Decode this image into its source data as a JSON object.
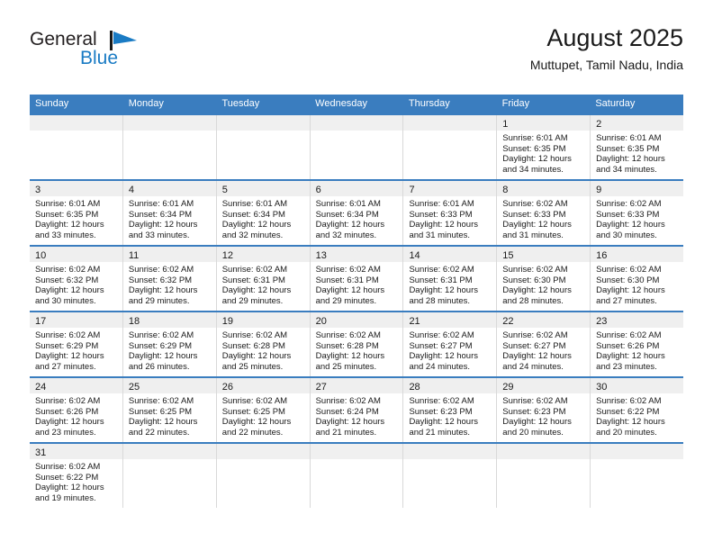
{
  "brand": {
    "name_part1": "General",
    "name_part2": "Blue",
    "logo_icon": "triangle-flag-icon",
    "accent_color": "#1a7bc4"
  },
  "header": {
    "title": "August 2025",
    "location": "Muttupet, Tamil Nadu, India"
  },
  "calendar": {
    "header_bg": "#3A7DBF",
    "daynum_bg": "#efefef",
    "weekdays": [
      "Sunday",
      "Monday",
      "Tuesday",
      "Wednesday",
      "Thursday",
      "Friday",
      "Saturday"
    ],
    "weeks": [
      [
        {
          "day": "",
          "lines": []
        },
        {
          "day": "",
          "lines": []
        },
        {
          "day": "",
          "lines": []
        },
        {
          "day": "",
          "lines": []
        },
        {
          "day": "",
          "lines": []
        },
        {
          "day": "1",
          "lines": [
            "Sunrise: 6:01 AM",
            "Sunset: 6:35 PM",
            "Daylight: 12 hours",
            "and 34 minutes."
          ]
        },
        {
          "day": "2",
          "lines": [
            "Sunrise: 6:01 AM",
            "Sunset: 6:35 PM",
            "Daylight: 12 hours",
            "and 34 minutes."
          ]
        }
      ],
      [
        {
          "day": "3",
          "lines": [
            "Sunrise: 6:01 AM",
            "Sunset: 6:35 PM",
            "Daylight: 12 hours",
            "and 33 minutes."
          ]
        },
        {
          "day": "4",
          "lines": [
            "Sunrise: 6:01 AM",
            "Sunset: 6:34 PM",
            "Daylight: 12 hours",
            "and 33 minutes."
          ]
        },
        {
          "day": "5",
          "lines": [
            "Sunrise: 6:01 AM",
            "Sunset: 6:34 PM",
            "Daylight: 12 hours",
            "and 32 minutes."
          ]
        },
        {
          "day": "6",
          "lines": [
            "Sunrise: 6:01 AM",
            "Sunset: 6:34 PM",
            "Daylight: 12 hours",
            "and 32 minutes."
          ]
        },
        {
          "day": "7",
          "lines": [
            "Sunrise: 6:01 AM",
            "Sunset: 6:33 PM",
            "Daylight: 12 hours",
            "and 31 minutes."
          ]
        },
        {
          "day": "8",
          "lines": [
            "Sunrise: 6:02 AM",
            "Sunset: 6:33 PM",
            "Daylight: 12 hours",
            "and 31 minutes."
          ]
        },
        {
          "day": "9",
          "lines": [
            "Sunrise: 6:02 AM",
            "Sunset: 6:33 PM",
            "Daylight: 12 hours",
            "and 30 minutes."
          ]
        }
      ],
      [
        {
          "day": "10",
          "lines": [
            "Sunrise: 6:02 AM",
            "Sunset: 6:32 PM",
            "Daylight: 12 hours",
            "and 30 minutes."
          ]
        },
        {
          "day": "11",
          "lines": [
            "Sunrise: 6:02 AM",
            "Sunset: 6:32 PM",
            "Daylight: 12 hours",
            "and 29 minutes."
          ]
        },
        {
          "day": "12",
          "lines": [
            "Sunrise: 6:02 AM",
            "Sunset: 6:31 PM",
            "Daylight: 12 hours",
            "and 29 minutes."
          ]
        },
        {
          "day": "13",
          "lines": [
            "Sunrise: 6:02 AM",
            "Sunset: 6:31 PM",
            "Daylight: 12 hours",
            "and 29 minutes."
          ]
        },
        {
          "day": "14",
          "lines": [
            "Sunrise: 6:02 AM",
            "Sunset: 6:31 PM",
            "Daylight: 12 hours",
            "and 28 minutes."
          ]
        },
        {
          "day": "15",
          "lines": [
            "Sunrise: 6:02 AM",
            "Sunset: 6:30 PM",
            "Daylight: 12 hours",
            "and 28 minutes."
          ]
        },
        {
          "day": "16",
          "lines": [
            "Sunrise: 6:02 AM",
            "Sunset: 6:30 PM",
            "Daylight: 12 hours",
            "and 27 minutes."
          ]
        }
      ],
      [
        {
          "day": "17",
          "lines": [
            "Sunrise: 6:02 AM",
            "Sunset: 6:29 PM",
            "Daylight: 12 hours",
            "and 27 minutes."
          ]
        },
        {
          "day": "18",
          "lines": [
            "Sunrise: 6:02 AM",
            "Sunset: 6:29 PM",
            "Daylight: 12 hours",
            "and 26 minutes."
          ]
        },
        {
          "day": "19",
          "lines": [
            "Sunrise: 6:02 AM",
            "Sunset: 6:28 PM",
            "Daylight: 12 hours",
            "and 25 minutes."
          ]
        },
        {
          "day": "20",
          "lines": [
            "Sunrise: 6:02 AM",
            "Sunset: 6:28 PM",
            "Daylight: 12 hours",
            "and 25 minutes."
          ]
        },
        {
          "day": "21",
          "lines": [
            "Sunrise: 6:02 AM",
            "Sunset: 6:27 PM",
            "Daylight: 12 hours",
            "and 24 minutes."
          ]
        },
        {
          "day": "22",
          "lines": [
            "Sunrise: 6:02 AM",
            "Sunset: 6:27 PM",
            "Daylight: 12 hours",
            "and 24 minutes."
          ]
        },
        {
          "day": "23",
          "lines": [
            "Sunrise: 6:02 AM",
            "Sunset: 6:26 PM",
            "Daylight: 12 hours",
            "and 23 minutes."
          ]
        }
      ],
      [
        {
          "day": "24",
          "lines": [
            "Sunrise: 6:02 AM",
            "Sunset: 6:26 PM",
            "Daylight: 12 hours",
            "and 23 minutes."
          ]
        },
        {
          "day": "25",
          "lines": [
            "Sunrise: 6:02 AM",
            "Sunset: 6:25 PM",
            "Daylight: 12 hours",
            "and 22 minutes."
          ]
        },
        {
          "day": "26",
          "lines": [
            "Sunrise: 6:02 AM",
            "Sunset: 6:25 PM",
            "Daylight: 12 hours",
            "and 22 minutes."
          ]
        },
        {
          "day": "27",
          "lines": [
            "Sunrise: 6:02 AM",
            "Sunset: 6:24 PM",
            "Daylight: 12 hours",
            "and 21 minutes."
          ]
        },
        {
          "day": "28",
          "lines": [
            "Sunrise: 6:02 AM",
            "Sunset: 6:23 PM",
            "Daylight: 12 hours",
            "and 21 minutes."
          ]
        },
        {
          "day": "29",
          "lines": [
            "Sunrise: 6:02 AM",
            "Sunset: 6:23 PM",
            "Daylight: 12 hours",
            "and 20 minutes."
          ]
        },
        {
          "day": "30",
          "lines": [
            "Sunrise: 6:02 AM",
            "Sunset: 6:22 PM",
            "Daylight: 12 hours",
            "and 20 minutes."
          ]
        }
      ],
      [
        {
          "day": "31",
          "lines": [
            "Sunrise: 6:02 AM",
            "Sunset: 6:22 PM",
            "Daylight: 12 hours",
            "and 19 minutes."
          ]
        },
        {
          "day": "",
          "lines": []
        },
        {
          "day": "",
          "lines": []
        },
        {
          "day": "",
          "lines": []
        },
        {
          "day": "",
          "lines": []
        },
        {
          "day": "",
          "lines": []
        },
        {
          "day": "",
          "lines": []
        }
      ]
    ]
  }
}
